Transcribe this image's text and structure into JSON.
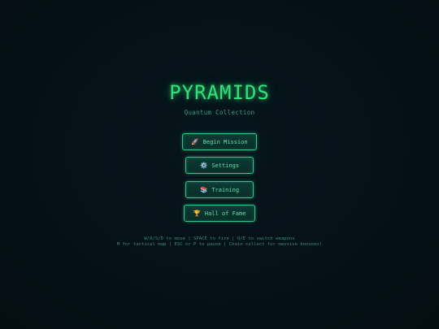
{
  "game": {
    "title": "PYRAMIDS",
    "subtitle": "Quantum Collection"
  },
  "menu": {
    "begin": {
      "icon": "🚀",
      "icon_name": "rocket-icon",
      "label": "Begin Mission"
    },
    "settings": {
      "icon": "⚙️",
      "icon_name": "gear-icon",
      "label": "Settings"
    },
    "training": {
      "icon": "📚",
      "icon_name": "books-icon",
      "label": "Training"
    },
    "hall": {
      "icon": "🏆",
      "icon_name": "trophy-icon",
      "label": "Hall of Fame"
    }
  },
  "help": {
    "line1": "W/A/S/D to move | SPACE to fire | Q/E to switch weapons",
    "line2": "M for tactical map | ESC or P to pause | Chain collect for massive bonuses!"
  },
  "colors": {
    "background": "#051117",
    "accent": "#33e07a",
    "button_border": "#35c48a",
    "button_fill": "#0b3330",
    "help_text": "#3f8a73"
  }
}
